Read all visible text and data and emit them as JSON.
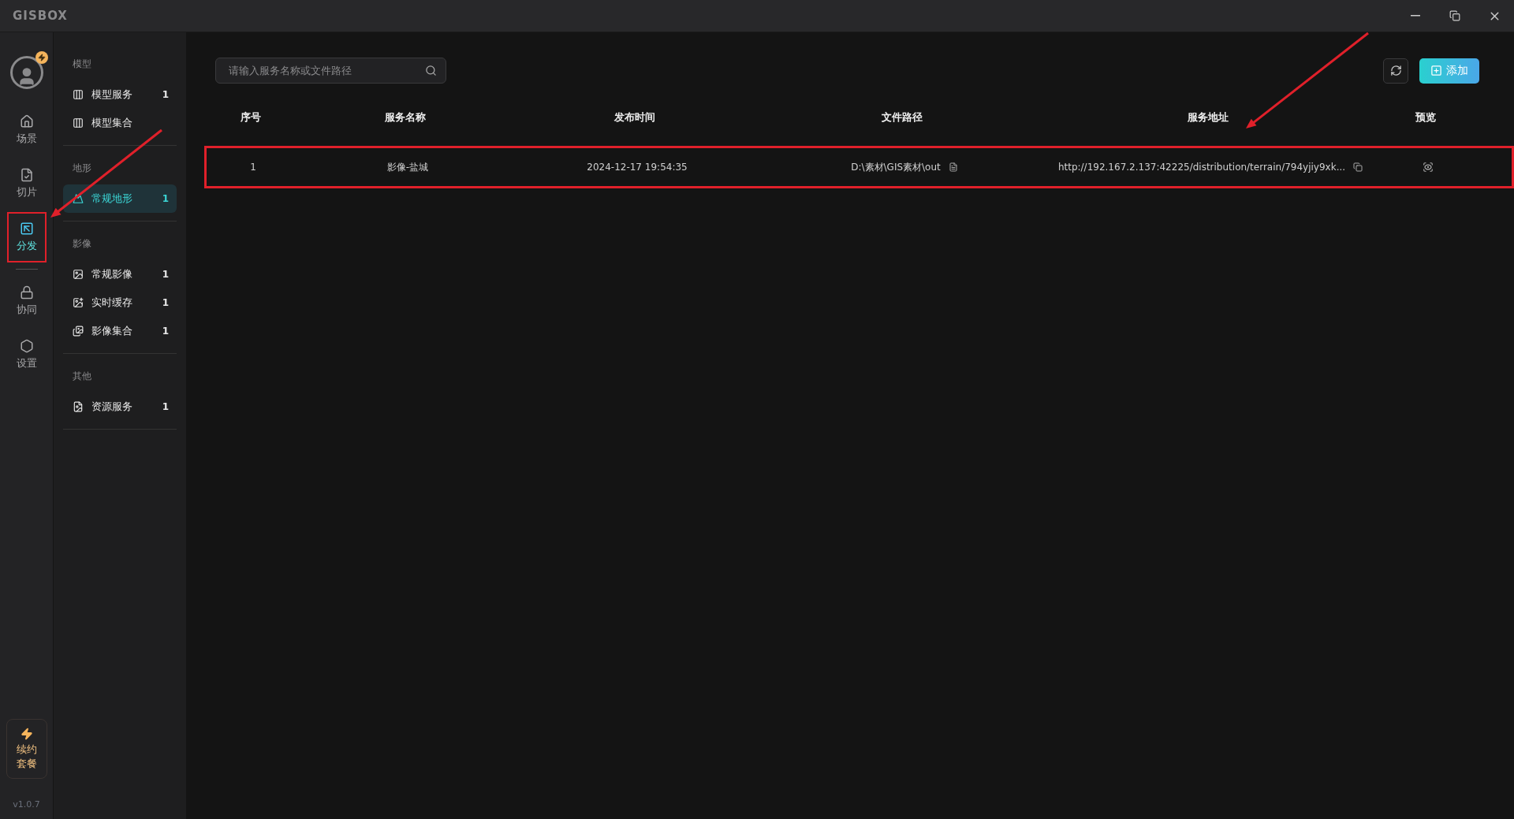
{
  "window": {
    "logo": "GISBOX"
  },
  "rail": {
    "items": [
      {
        "label": "场景",
        "kind": "scene",
        "selected": false,
        "highlighted": false
      },
      {
        "label": "切片",
        "kind": "tile",
        "selected": false,
        "highlighted": false
      },
      {
        "label": "分发",
        "kind": "distribute",
        "selected": true,
        "highlighted": true
      },
      {
        "label": "协同",
        "kind": "collab",
        "selected": false,
        "highlighted": false
      },
      {
        "label": "设置",
        "kind": "settings",
        "selected": false,
        "highlighted": false
      }
    ],
    "renew": "续约套餐",
    "version": "v1.0.7"
  },
  "nav": {
    "groups": [
      {
        "title": "模型",
        "items": [
          {
            "label": "模型服务",
            "count": "1",
            "selected": false
          },
          {
            "label": "模型集合",
            "selected": false
          }
        ]
      },
      {
        "title": "地形",
        "items": [
          {
            "label": "常规地形",
            "count": "1",
            "selected": true
          }
        ]
      },
      {
        "title": "影像",
        "items": [
          {
            "label": "常规影像",
            "count": "1",
            "selected": false
          },
          {
            "label": "实时缓存",
            "count": "1",
            "selected": false
          },
          {
            "label": "影像集合",
            "count": "1",
            "selected": false
          }
        ]
      },
      {
        "title": "其他",
        "items": [
          {
            "label": "资源服务",
            "count": "1",
            "selected": false
          }
        ]
      }
    ]
  },
  "search": {
    "placeholder": "请输入服务名称或文件路径"
  },
  "add_button": "添加",
  "table": {
    "columns": [
      "序号",
      "服务名称",
      "发布时间",
      "文件路径",
      "服务地址",
      "预览"
    ],
    "rows": [
      {
        "index": "1",
        "name": "影像-盐城",
        "time": "2024-12-17 19:54:35",
        "path": "D:\\素材\\GIS素材\\out",
        "url": "http://192.167.2.137:42225/distribution/terrain/794yjiy9xk...",
        "highlighted": true
      }
    ]
  }
}
